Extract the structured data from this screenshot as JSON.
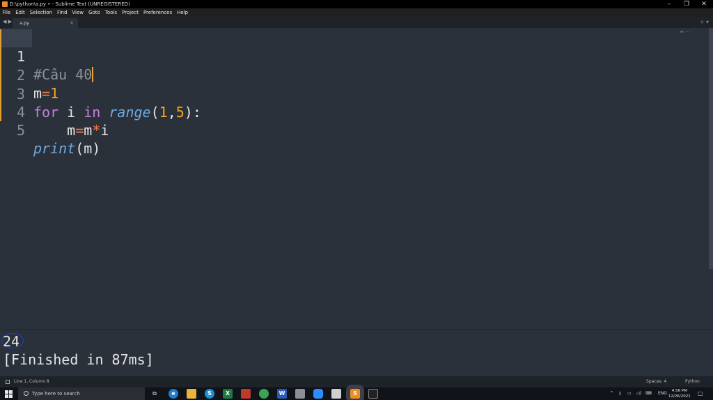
{
  "window": {
    "title": "D:\\python\\a.py • - Sublime Text (UNREGISTERED)"
  },
  "menu": [
    "File",
    "Edit",
    "Selection",
    "Find",
    "View",
    "Goto",
    "Tools",
    "Project",
    "Preferences",
    "Help"
  ],
  "tab": {
    "label": "a.py",
    "close": "×"
  },
  "editor": {
    "line_numbers": [
      "1",
      "2",
      "3",
      "4",
      "5"
    ],
    "l1": {
      "comment": "#Câu 40"
    },
    "l2": {
      "var": "m",
      "op": "=",
      "num": "1"
    },
    "l3": {
      "kw_for": "for",
      "var": " i ",
      "kw_in": "in",
      "sp": " ",
      "fn": "range",
      "open": "(",
      "n1": "1",
      "comma": ",",
      "n2": "5",
      "close": "):"
    },
    "l4": {
      "indent": "    ",
      "a": "m",
      "eq": "=",
      "b": "m",
      "mul": "*",
      "c": "i"
    },
    "l5": {
      "fn": "print",
      "args": "(m)"
    }
  },
  "output": {
    "result": "24",
    "finished": "[Finished in 87ms]"
  },
  "status": {
    "position": "Line 1, Column 8",
    "spaces": "Spaces: 4",
    "syntax": "Python"
  },
  "taskbar": {
    "search_placeholder": "Type here to search",
    "language": "ENG",
    "time": "4:56 PM",
    "date": "12/26/2021"
  },
  "colors": {
    "accent": "#f5a623",
    "keyword": "#c580d8",
    "function": "#6fa8e0",
    "editor_bg": "#2b313a"
  }
}
